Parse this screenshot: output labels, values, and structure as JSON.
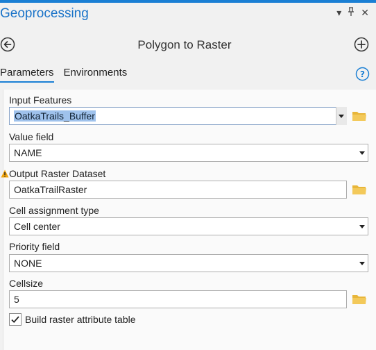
{
  "pane": {
    "title": "Geoprocessing",
    "controls": {
      "menu_glyph": "▾",
      "pin_glyph": "ᵖ",
      "close_glyph": "✕"
    }
  },
  "tool": {
    "title": "Polygon to Raster",
    "back_icon": "arrow-left-circle-icon",
    "add_icon": "plus-circle-icon"
  },
  "tabs": [
    {
      "label": "Parameters",
      "active": true
    },
    {
      "label": "Environments",
      "active": false
    }
  ],
  "help_icon": "question-circle-icon",
  "params": {
    "input_features": {
      "label": "Input Features",
      "value": "OatkaTrails_Buffer"
    },
    "value_field": {
      "label": "Value field",
      "value": "NAME"
    },
    "output_raster": {
      "label": "Output Raster Dataset",
      "value": "OatkaTrailRaster",
      "warning_icon": "warning-icon"
    },
    "cell_assignment": {
      "label": "Cell assignment type",
      "value": "Cell center"
    },
    "priority_field": {
      "label": "Priority field",
      "value": "NONE"
    },
    "cellsize": {
      "label": "Cellsize",
      "value": "5"
    },
    "build_rat": {
      "label": "Build raster attribute table",
      "checked": true
    }
  },
  "colors": {
    "accent": "#1a7fd4",
    "selection": "#9fc2ec",
    "folder": "#e8b63a",
    "warning": "#f0a30a"
  }
}
